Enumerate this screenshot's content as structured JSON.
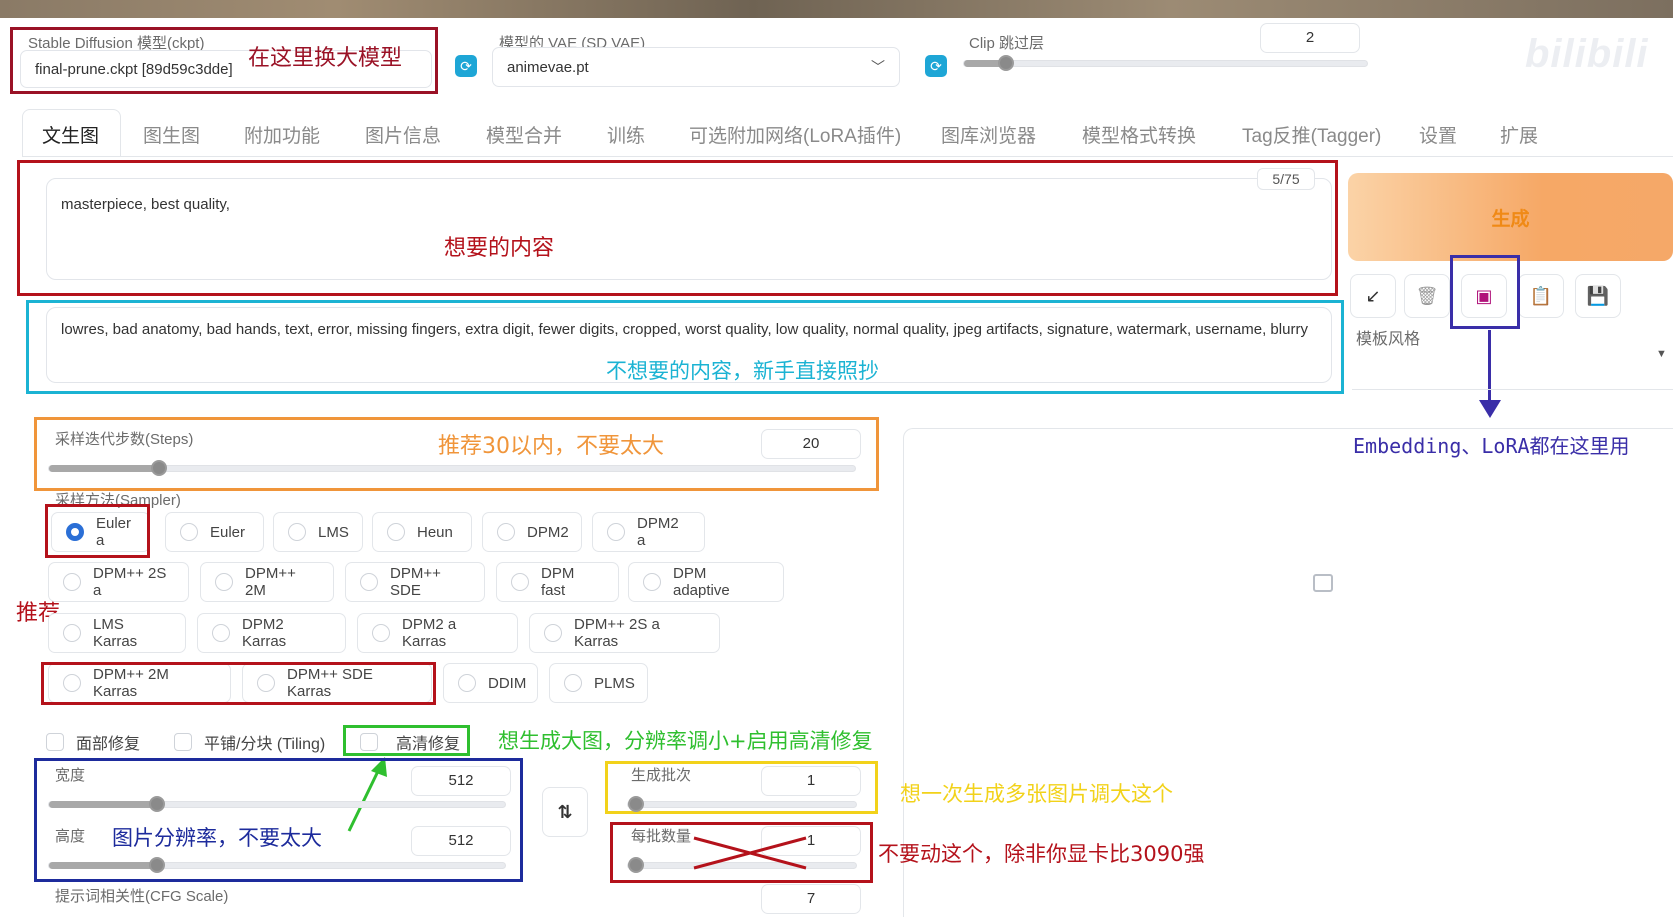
{
  "watermark": "bilibili",
  "top": {
    "ckpt_label": "Stable Diffusion 模型(ckpt)",
    "ckpt_value": "final-prune.ckpt [89d59c3dde]",
    "ckpt_annotation": "在这里换大模型",
    "vae_label": "模型的 VAE (SD VAE)",
    "vae_value": "animevae.pt",
    "clip_label": "Clip 跳过层",
    "clip_value": "2"
  },
  "tabs": [
    "文生图",
    "图生图",
    "附加功能",
    "图片信息",
    "模型合并",
    "训练",
    "可选附加网络(LoRA插件)",
    "图库浏览器",
    "模型格式转换",
    "Tag反推(Tagger)",
    "设置",
    "扩展"
  ],
  "prompt": {
    "text": "masterpiece, best quality,",
    "counter": "5/75",
    "annotation": "想要的内容"
  },
  "negative": {
    "text": "lowres, bad anatomy, bad hands, text, error, missing fingers, extra digit, fewer digits, cropped, worst quality, low quality, normal quality, jpeg artifacts, signature, watermark, username, blurry",
    "annotation": "不想要的内容，新手直接照抄"
  },
  "generate_label": "生成",
  "styles_label": "模板风格",
  "tool_icons": [
    "arrow-icon",
    "trash-icon",
    "extra-networks-icon",
    "clipboard-icon",
    "save-icon"
  ],
  "embedding_annotation": "Embedding、LoRA都在这里用",
  "steps": {
    "label": "采样迭代步数(Steps)",
    "value": "20",
    "annotation": "推荐30以内，不要太大"
  },
  "sampler": {
    "label": "采样方法(Sampler)",
    "selected": "Euler a",
    "recommend_annotation": "推荐",
    "rows": [
      [
        "Euler a",
        "Euler",
        "LMS",
        "Heun",
        "DPM2",
        "DPM2 a"
      ],
      [
        "DPM++ 2S a",
        "DPM++ 2M",
        "DPM++ SDE",
        "DPM fast",
        "DPM adaptive"
      ],
      [
        "LMS Karras",
        "DPM2 Karras",
        "DPM2 a Karras",
        "DPM++ 2S a Karras"
      ],
      [
        "DPM++ 2M Karras",
        "DPM++ SDE Karras",
        "DDIM",
        "PLMS"
      ]
    ]
  },
  "options": {
    "face_restore": "面部修复",
    "tiling": "平铺/分块 (Tiling)",
    "hires_fix": "高清修复",
    "hires_annotation": "想生成大图，分辨率调小+启用高清修复"
  },
  "size": {
    "width_label": "宽度",
    "width_value": "512",
    "height_label": "高度",
    "height_value": "512",
    "annotation": "图片分辨率，不要太大"
  },
  "batch": {
    "count_label": "生成批次",
    "count_value": "1",
    "count_annotation": "想一次生成多张图片调大这个",
    "size_label": "每批数量",
    "size_value": "1",
    "size_annotation": "不要动这个，除非你显卡比3090强"
  },
  "cfg": {
    "label": "提示词相关性(CFG Scale)",
    "value": "7"
  },
  "colors": {
    "red_box": "#b4121b",
    "cyan_box": "#1bb3d3",
    "orange_box": "#f0953a",
    "blue_box": "#1d2b9c",
    "green_box": "#2fbf2f",
    "yellow_box": "#f2d21a",
    "purple_box": "#3a2ea8"
  }
}
